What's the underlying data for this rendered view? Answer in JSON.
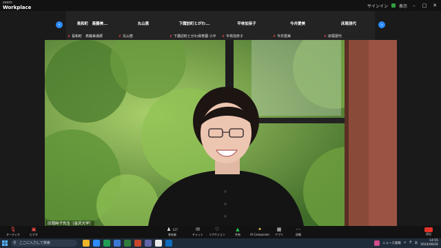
{
  "window": {
    "brand_small": "zoom",
    "brand_large": "Workplace",
    "signin_label": "サインイン",
    "view_label": "表示"
  },
  "participants": [
    {
      "name": "長和町　斎藤美...",
      "sub": "長和町　斎藤美満那"
    },
    {
      "name": "丸山恵",
      "sub": "丸山恵"
    },
    {
      "name": "下諏訪町とがわ...",
      "sub": "下諏訪町とがわ保育園 小平"
    },
    {
      "name": "平林加奈子",
      "sub": "平林加奈子"
    },
    {
      "name": "今井愛美",
      "sub": "今井愛美"
    },
    {
      "name": "床尾朋代",
      "sub": "床尾朋代"
    }
  ],
  "speaker": {
    "label": "田頭純子先生（金沢大学）"
  },
  "toolbar": {
    "audio": "オーディオ",
    "video": "ビデオ",
    "participants": "参加者",
    "participants_count": "127",
    "chat": "チャット",
    "reactions": "リアクション",
    "share": "共有",
    "ai": "AI Companion",
    "apps": "アプリ",
    "more": "詳細",
    "leave": "退出"
  },
  "taskbar": {
    "search_placeholder": "ここに入力して検索",
    "news": "ニュース速報",
    "time": "14:55",
    "date": "2024/08/26",
    "lang": "あ"
  },
  "colors": {
    "accent": "#2d8cff",
    "leave": "#e5332a",
    "muted_mic": "#ff4d4d",
    "share_green": "#23c552"
  }
}
